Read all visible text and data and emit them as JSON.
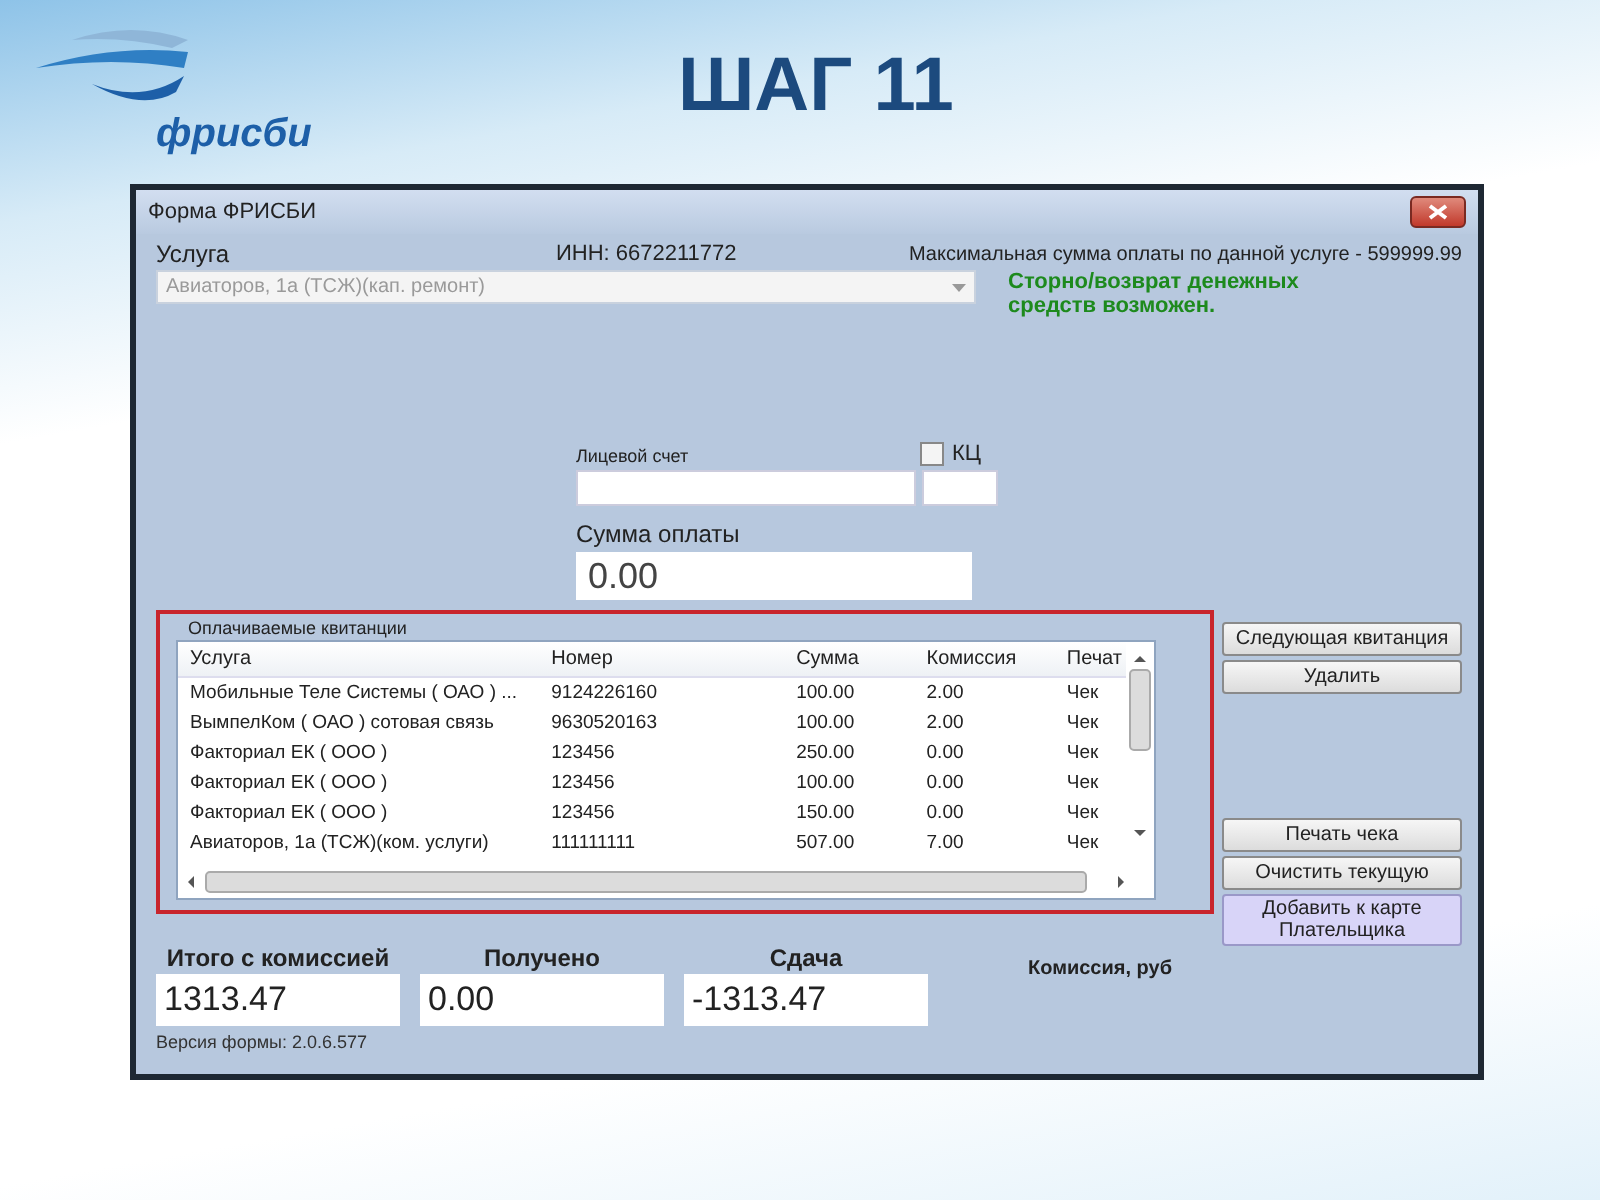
{
  "slide": {
    "logo_text": "фрисби",
    "title": "ШАГ 11"
  },
  "window": {
    "title": "Форма ФРИСБИ"
  },
  "service": {
    "label": "Услуга",
    "value": "Авиаторов, 1а (ТСЖ)(кап. ремонт)",
    "disabled": true
  },
  "inn": "ИНН: 6672211772",
  "max_sum": "Максимальная сумма оплаты по данной услуге - 599999.99",
  "refund_note": "Сторно/возврат денежных средств возможен.",
  "account": {
    "label": "Лицевой счет",
    "kc_label": "КЦ",
    "kc_checked": false
  },
  "payment": {
    "label": "Сумма оплаты",
    "value": "0.00"
  },
  "receipts": {
    "title": "Оплачиваемые квитанции",
    "columns": [
      "Услуга",
      "Номер",
      "Сумма",
      "Комиссия",
      "Печат"
    ],
    "rows": [
      {
        "cells": [
          "Мобильные Теле Системы ( ОАО ) ...",
          "9124226160",
          "100.00",
          "2.00",
          "Чек"
        ],
        "selected": false
      },
      {
        "cells": [
          "ВымпелКом ( ОАО ) сотовая связь",
          "9630520163",
          "100.00",
          "2.00",
          "Чек"
        ],
        "selected": false
      },
      {
        "cells": [
          "Факториал ЕК ( ООО )",
          "123456",
          "250.00",
          "0.00",
          "Чек"
        ],
        "selected": false
      },
      {
        "cells": [
          "Факториал ЕК ( ООО )",
          "123456",
          "100.00",
          "0.00",
          "Чек"
        ],
        "selected": false
      },
      {
        "cells": [
          "Факториал ЕК ( ООО )",
          "123456",
          "150.00",
          "0.00",
          "Чек"
        ],
        "selected": false
      },
      {
        "cells": [
          "Авиаторов, 1а (ТСЖ)(ком. услуги)",
          "111111111",
          "507.00",
          "7.00",
          "Чек"
        ],
        "selected": false
      }
    ]
  },
  "side_buttons_top": [
    {
      "label": "Следующая квитанция",
      "highlighted": false
    },
    {
      "label": "Удалить",
      "highlighted": false
    }
  ],
  "side_buttons_bottom": [
    {
      "label": "Печать чека",
      "highlighted": false
    },
    {
      "label": "Очистить текущую",
      "highlighted": false
    },
    {
      "label": "Добавить к карте Плательщика",
      "highlighted": true
    }
  ],
  "totals": [
    {
      "label": "Итого с комиссией",
      "value": "1313.47"
    },
    {
      "label": "Получено",
      "value": "0.00"
    },
    {
      "label": "Сдача",
      "value": "-1313.47"
    }
  ],
  "commission_label": "Комиссия, руб",
  "version": "Версия формы: 2.0.6.577"
}
